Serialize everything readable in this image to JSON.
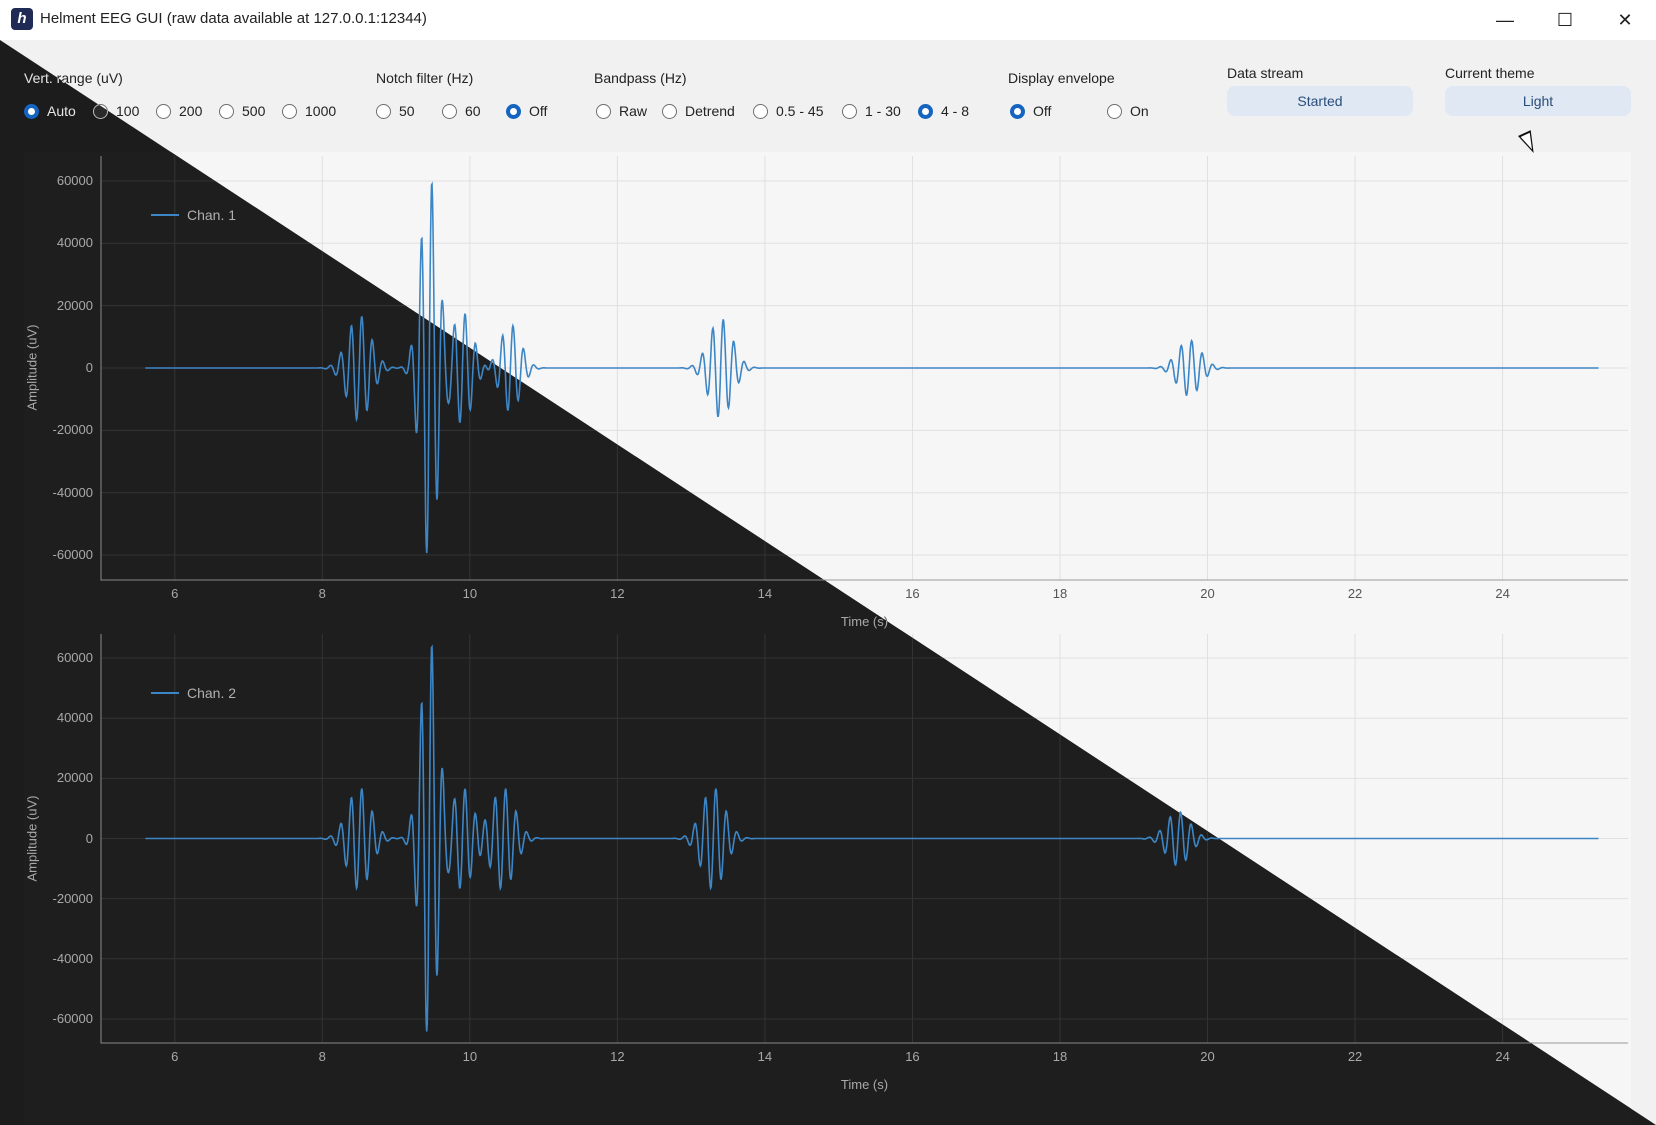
{
  "window": {
    "title": "Helment EEG GUI (raw data available at 127.0.0.1:12344)",
    "app_icon": "helment-logo-icon",
    "minimize_label": "—",
    "maximize_label": "☐",
    "close_label": "✕"
  },
  "controls": {
    "vert_range": {
      "label": "Vert. range (uV)",
      "options": [
        "Auto",
        "100",
        "200",
        "500",
        "1000"
      ],
      "selected": "Auto"
    },
    "notch_filter": {
      "label": "Notch filter (Hz)",
      "options": [
        "50",
        "60",
        "Off"
      ],
      "selected": "Off"
    },
    "bandpass": {
      "label": "Bandpass (Hz)",
      "options": [
        "Raw",
        "Detrend",
        "0.5 - 45",
        "1 - 30",
        "4 - 8"
      ],
      "selected": "4 - 8"
    },
    "display_envelope": {
      "label": "Display envelope",
      "options": [
        "Off",
        "On"
      ],
      "selected": "Off"
    },
    "data_stream": {
      "label": "Data stream",
      "button": "Started"
    },
    "current_theme": {
      "label": "Current theme",
      "button": "Light"
    }
  },
  "accent_color": "#1565c0",
  "trace_color": "#3d86c6",
  "chart_data": [
    {
      "type": "line",
      "series": [
        {
          "name": "Chan. 1"
        }
      ],
      "xlabel": "Time (s)",
      "ylabel": "Amplitude (uV)",
      "xlim": [
        5.0,
        25.7
      ],
      "ylim": [
        -68000,
        68000
      ],
      "xticks": [
        6,
        8,
        10,
        12,
        14,
        16,
        18,
        20,
        22,
        24
      ],
      "yticks": [
        60000,
        40000,
        20000,
        0,
        -20000,
        -40000,
        -60000
      ],
      "ytick_labels": [
        "60000",
        "40000",
        "20000",
        "0",
        "-20000",
        "-40000",
        "-60000"
      ],
      "xtick_labels": [
        "6",
        "8",
        "10",
        "12",
        "14",
        "16",
        "18",
        "20",
        "22",
        "24"
      ],
      "grid": true,
      "legend": "top-left",
      "x_start": 5.6,
      "x_end": 25.3,
      "bursts": [
        {
          "t": 8.5,
          "amp": 17000,
          "dur": 0.8
        },
        {
          "t": 9.45,
          "amp": 62000,
          "dur": 0.6
        },
        {
          "t": 9.9,
          "amp": 18000,
          "dur": 0.7
        },
        {
          "t": 10.55,
          "amp": 14000,
          "dur": 0.7
        },
        {
          "t": 13.4,
          "amp": 16000,
          "dur": 0.8
        },
        {
          "t": 19.75,
          "amp": 9000,
          "dur": 0.8
        }
      ]
    },
    {
      "type": "line",
      "series": [
        {
          "name": "Chan. 2"
        }
      ],
      "xlabel": "Time (s)",
      "ylabel": "Amplitude (uV)",
      "xlim": [
        5.0,
        25.7
      ],
      "ylim": [
        -68000,
        68000
      ],
      "xticks": [
        6,
        8,
        10,
        12,
        14,
        16,
        18,
        20,
        22,
        24
      ],
      "yticks": [
        60000,
        40000,
        20000,
        0,
        -20000,
        -40000,
        -60000
      ],
      "ytick_labels": [
        "60000",
        "40000",
        "20000",
        "0",
        "-20000",
        "-40000",
        "-60000"
      ],
      "xtick_labels": [
        "6",
        "8",
        "10",
        "12",
        "14",
        "16",
        "18",
        "20",
        "22",
        "24"
      ],
      "grid": true,
      "legend": "top-left",
      "x_start": 5.6,
      "x_end": 25.3,
      "bursts": [
        {
          "t": 8.5,
          "amp": 17000,
          "dur": 0.8
        },
        {
          "t": 9.45,
          "amp": 67000,
          "dur": 0.6
        },
        {
          "t": 9.9,
          "amp": 17000,
          "dur": 0.7
        },
        {
          "t": 10.45,
          "amp": 17000,
          "dur": 0.8
        },
        {
          "t": 13.3,
          "amp": 17000,
          "dur": 0.8
        },
        {
          "t": 19.6,
          "amp": 9000,
          "dur": 0.8
        }
      ]
    }
  ]
}
